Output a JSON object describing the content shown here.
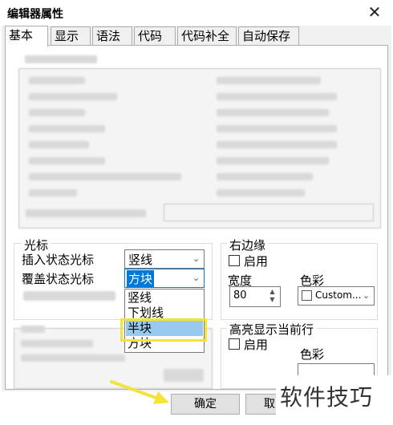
{
  "window": {
    "title": "编辑器属性",
    "close_glyph": "✕"
  },
  "tabs": [
    {
      "label": "基本",
      "active": true
    },
    {
      "label": "显示",
      "active": false
    },
    {
      "label": "语法",
      "active": false
    },
    {
      "label": "代码",
      "active": false
    },
    {
      "label": "代码补全",
      "active": false
    },
    {
      "label": "自动保存",
      "active": false
    }
  ],
  "cursor_group": {
    "legend": "光标",
    "insert_label": "插入状态光标",
    "insert_value": "竖线",
    "overwrite_label": "覆盖状态光标",
    "overwrite_value": "方块"
  },
  "cursor_dropdown": {
    "options": [
      "竖线",
      "下划线",
      "半块",
      "方块"
    ],
    "selected_index": 2
  },
  "right_edge_group": {
    "legend": "右边缘",
    "enable_label": "启用",
    "width_label": "宽度",
    "width_value": "80",
    "color_label": "色彩",
    "color_value": "Custom..."
  },
  "highlight_group": {
    "legend": "高亮显示当前行",
    "enable_label": "启用",
    "color_label": "色彩"
  },
  "buttons": {
    "ok": "确定",
    "cancel_partial": "取"
  },
  "watermark": "软件技巧",
  "colors": {
    "highlight": "#99c9ef",
    "annotation": "#f2e43a"
  }
}
